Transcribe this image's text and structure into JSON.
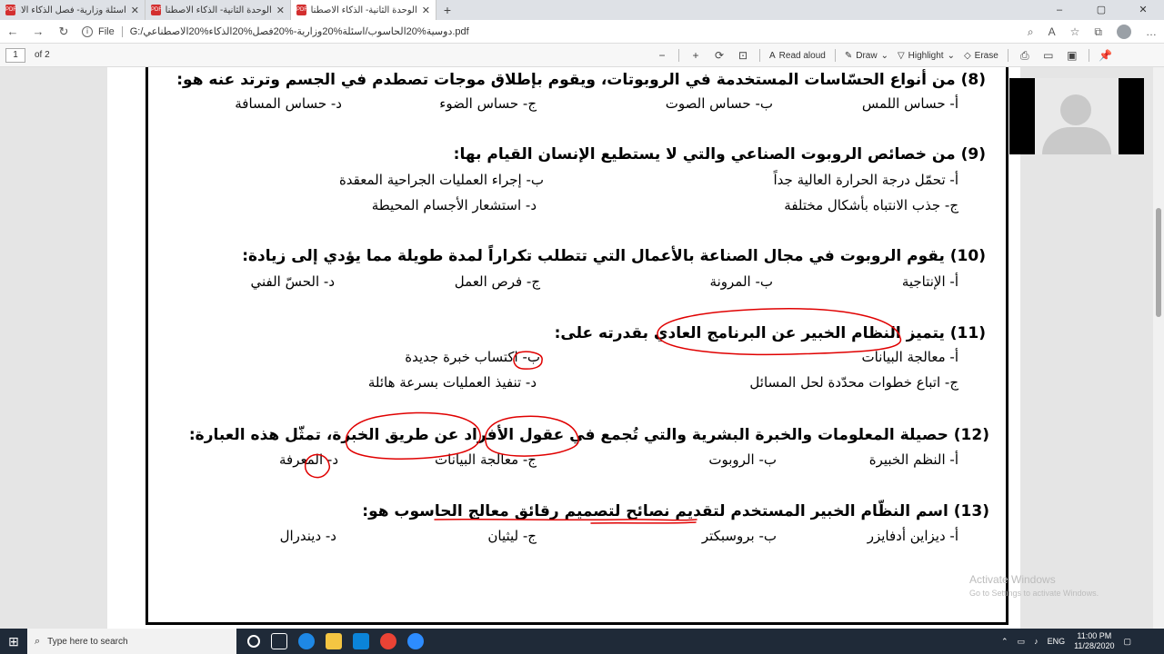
{
  "browser": {
    "tabs": [
      {
        "title": "اسئلة وزارية- فصل الذكاء الاصطنا"
      },
      {
        "title": "الوحدة الثانية- الذكاء الاصطناعي.pdf"
      },
      {
        "title": "الوحدة الثانية- الذكاء الاصطناعي.pdf"
      }
    ],
    "new_tab": "+",
    "window_controls": {
      "minimize": "–",
      "maximize": "▢",
      "close": "✕"
    },
    "address": {
      "scheme_label": "File",
      "url": "G:/دوسية%20الحاسوب/اسئلة%20وزارية-%20فصل%20الذكاء%20الاصطناعي.pdf"
    }
  },
  "pdf_toolbar": {
    "page_number": "1",
    "page_count": "of 2",
    "minus": "−",
    "plus": "+",
    "read_aloud": "Read aloud",
    "draw": "Draw",
    "highlight": "Highlight",
    "erase": "Erase"
  },
  "document": {
    "questions": [
      {
        "text": "(8) من أنواع الحسّاسات المستخدمة في الروبوتات، ويقوم بإطلاق موجات تصطدم في الجسم وترتد عنه هو:",
        "options": [
          "أ- حساس اللمس",
          "ب- حساس الصوت",
          "ج- حساس الضوء",
          "د- حساس المسافة"
        ]
      },
      {
        "text": "(9) من خصائص الروبوت الصناعي والتي لا يستطيع الإنسان القيام بها:",
        "options": [
          "أ- تحمّل درجة الحرارة العالية جداً",
          "ب- إجراء العمليات الجراحية المعقدة",
          "ج- جذب الانتباه بأشكال مختلفة",
          "د- استشعار الأجسام المحيطة"
        ]
      },
      {
        "text": "(10) يقوم الروبوت في مجال الصناعة بالأعمال التي تتطلب تكراراً لمدة طويلة مما يؤدي إلى زيادة:",
        "options": [
          "أ- الإنتاجية",
          "ب- المرونة",
          "ج- فرص العمل",
          "د- الحسّ الفني"
        ]
      },
      {
        "text": "(11) يتميز النظام الخبير عن البرنامج العادي بقدرته على:",
        "options": [
          "أ- معالجة البيانات",
          "ب- اكتساب خبرة جديدة",
          "ج- اتباع خطوات محدّدة لحل المسائل",
          "د- تنفيذ العمليات بسرعة هائلة"
        ]
      },
      {
        "text": "(12) حصيلة المعلومات والخبرة البشرية والتي تُجمع في عقول الأفراد عن طريق الخبرة، تمثّل هذه العبارة:",
        "options": [
          "أ- النظم الخبيرة",
          "ب- الروبوت",
          "ج- معالجة البيانات",
          "د- المعرفة"
        ]
      },
      {
        "text": "(13) اسم النظّام الخبير المستخدم لتقديم نصائح لتصميم رقائق معالج الحاسوب هو:",
        "options": [
          "أ- ديزاين أدفايزر",
          "ب- بروسبكتر",
          "ج- ليثيان",
          "د- ديندرال"
        ]
      }
    ]
  },
  "watermark": {
    "title": "Activate Windows",
    "subtitle": "Go to Settings to activate Windows."
  },
  "taskbar": {
    "search_placeholder": "Type here to search",
    "language": "ENG",
    "time": "11:00 PM",
    "date": "11/28/2020"
  },
  "colors": {
    "pen": "#e00000",
    "pdf_icon": "#d32f2f",
    "taskbar": "#1f2a38"
  }
}
